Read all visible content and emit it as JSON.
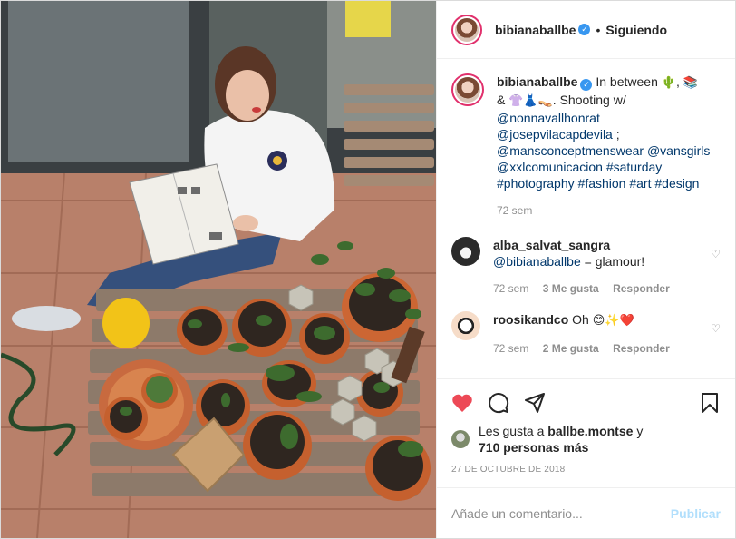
{
  "post": {
    "owner": "bibianaballbe",
    "follow_status": "Siguiendo",
    "separator": "•",
    "caption_prefix": "In between",
    "caption_line1_tail": ",",
    "caption_line2": "&",
    "caption_line2_tail": ". Shooting w/",
    "emoji_cactus": "🌵",
    "emoji_books": "📚",
    "emoji_shirt": "👚",
    "emoji_dress": "👗",
    "emoji_heels": "👡",
    "mentions": [
      "@nonnavallhonrat",
      "@josepvilacapdevila",
      "@mansconceptmenswear",
      "@vansgirls",
      "@xxlcomunicacion"
    ],
    "semicolon": ";",
    "hashtags_line1": "#saturday",
    "hashtags_line2": [
      "#photography",
      "#fashion",
      "#art",
      "#design"
    ],
    "time": "72 sem"
  },
  "comments": [
    {
      "user": "alba_salvat_sangra",
      "mention": "@bibianaballbe",
      "text": "= glamour!",
      "time": "72 sem",
      "likes": "3 Me gusta",
      "reply": "Responder"
    },
    {
      "user": "roosikandco",
      "text": "Oh",
      "emojis": "😊✨❤️",
      "time": "72 sem",
      "likes": "2 Me gusta",
      "reply": "Responder"
    }
  ],
  "likes": {
    "prefix": "Les gusta a",
    "user": "ballbe.montse",
    "connector": "y",
    "others": "710 personas más"
  },
  "date": "27 DE OCTUBRE DE 2018",
  "add_comment": {
    "placeholder": "Añade un comentario...",
    "publish": "Publicar"
  },
  "colors": {
    "like_active": "#ed4956",
    "link": "#00376b",
    "verified": "#3897f0",
    "publish_disabled": "#b2dffc"
  },
  "icons": [
    "verified-badge-icon",
    "heart-icon",
    "comment-icon",
    "share-icon",
    "bookmark-icon",
    "like-small-icon"
  ]
}
